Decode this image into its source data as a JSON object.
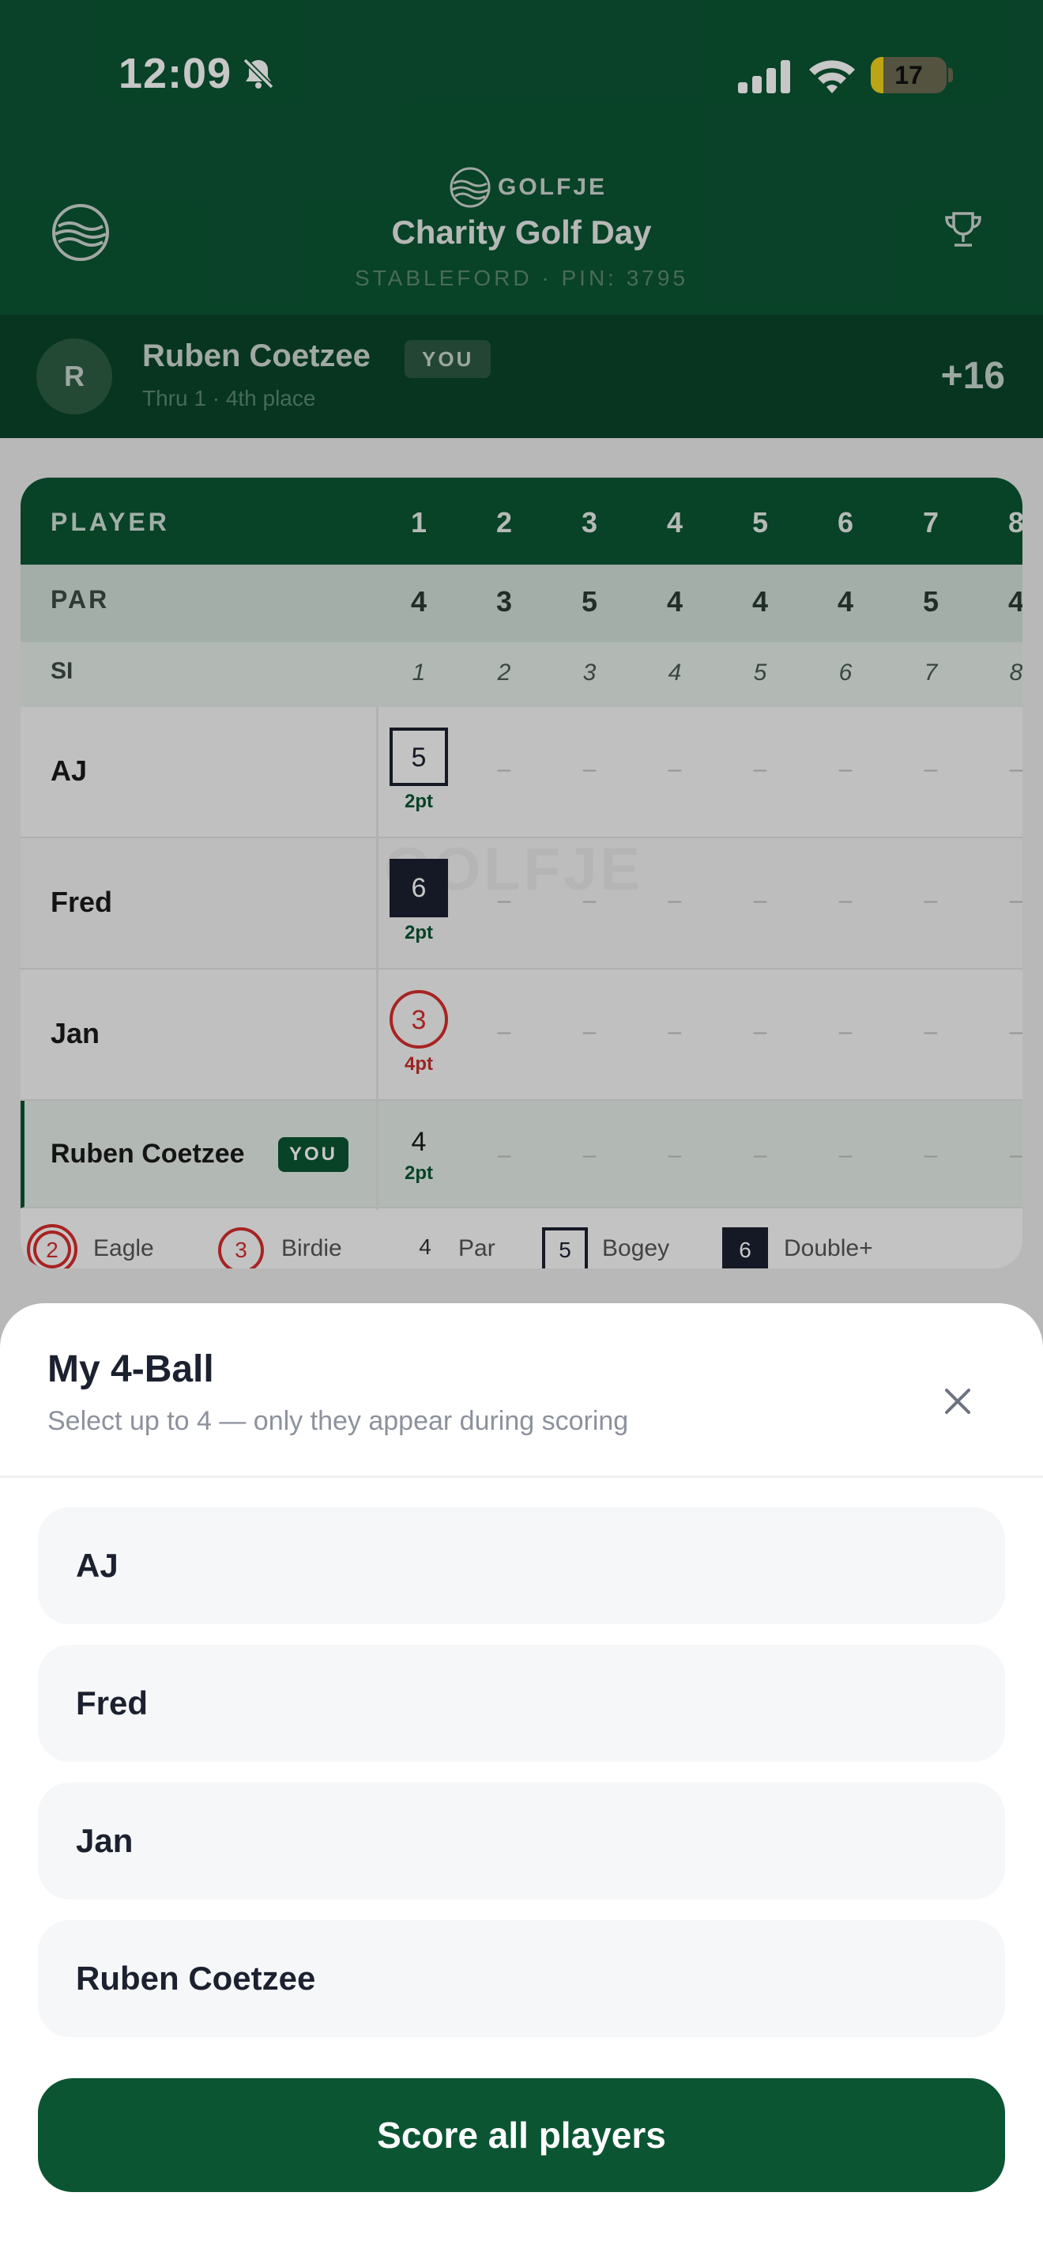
{
  "status_bar": {
    "time": "12:09",
    "battery": "17",
    "battery_level": 0.17
  },
  "header": {
    "brand": "GOLFJE",
    "event_title": "Charity Golf Day",
    "event_sub": "STABLEFORD · PIN: 3795"
  },
  "current_user": {
    "initial": "R",
    "name": "Ruben Coetzee",
    "badge": "YOU",
    "status": "Thru 1 · 4th place",
    "score": "+16"
  },
  "scorecard": {
    "player_header": "PLAYER",
    "par_label": "PAR",
    "si_label": "SI",
    "holes": [
      "1",
      "2",
      "3",
      "4",
      "5",
      "6",
      "7",
      "8"
    ],
    "par": [
      "4",
      "3",
      "5",
      "4",
      "4",
      "4",
      "5",
      "4"
    ],
    "si": [
      "1",
      "2",
      "3",
      "4",
      "5",
      "6",
      "7",
      "8"
    ],
    "empty_mark": "–",
    "watermark": "GOLFJE",
    "players": [
      {
        "name": "AJ",
        "score": "5",
        "points": "2pt",
        "type": "bogey"
      },
      {
        "name": "Fred",
        "score": "6",
        "points": "2pt",
        "type": "double"
      },
      {
        "name": "Jan",
        "score": "3",
        "points": "4pt",
        "type": "birdie"
      },
      {
        "name": "Ruben Coetzee",
        "badge": "YOU",
        "score": "4",
        "points": "2pt",
        "type": "par"
      }
    ],
    "legend": [
      {
        "mark": "2",
        "label": "Eagle"
      },
      {
        "mark": "3",
        "label": "Birdie"
      },
      {
        "mark": "4",
        "label": "Par"
      },
      {
        "mark": "5",
        "label": "Bogey"
      },
      {
        "mark": "6",
        "label": "Double+"
      }
    ]
  },
  "sheet": {
    "title": "My 4-Ball",
    "subtitle": "Select up to 4 — only they appear during scoring",
    "options": [
      "AJ",
      "Fred",
      "Jan",
      "Ruben Coetzee"
    ],
    "cta": "Score all players"
  },
  "colors": {
    "brand_green": "#0b5533",
    "birdie_red": "#d72e2e",
    "dark": "#1b2030"
  }
}
